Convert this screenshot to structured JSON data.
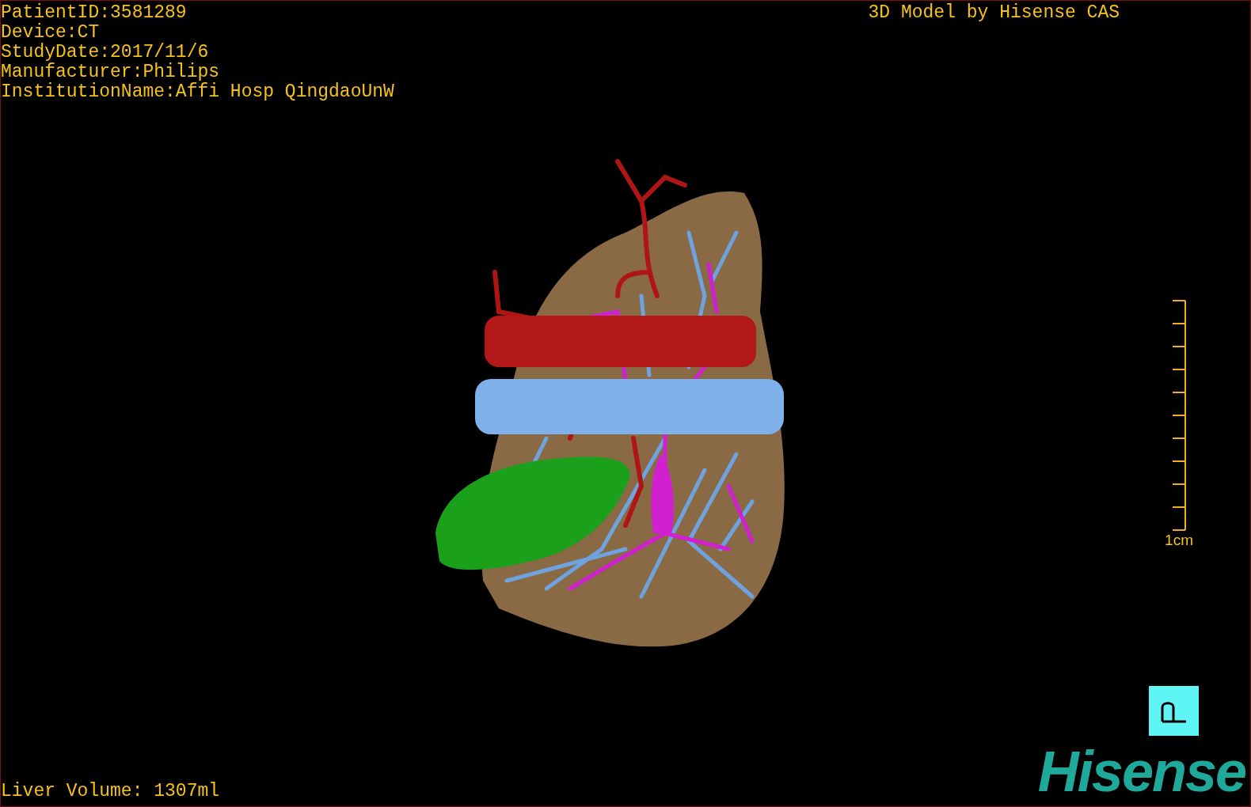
{
  "study_info": [
    "PatientID:3581289",
    "Device:CT",
    "StudyDate:2017/11/6",
    "Manufacturer:Philips",
    "InstitutionName:Affi Hosp QingdaoUnW"
  ],
  "title": "3D Model by Hisense CAS",
  "scale_label": "1cm",
  "liver_volume": "Liver Volume: 1307ml",
  "logo": "Hisense"
}
